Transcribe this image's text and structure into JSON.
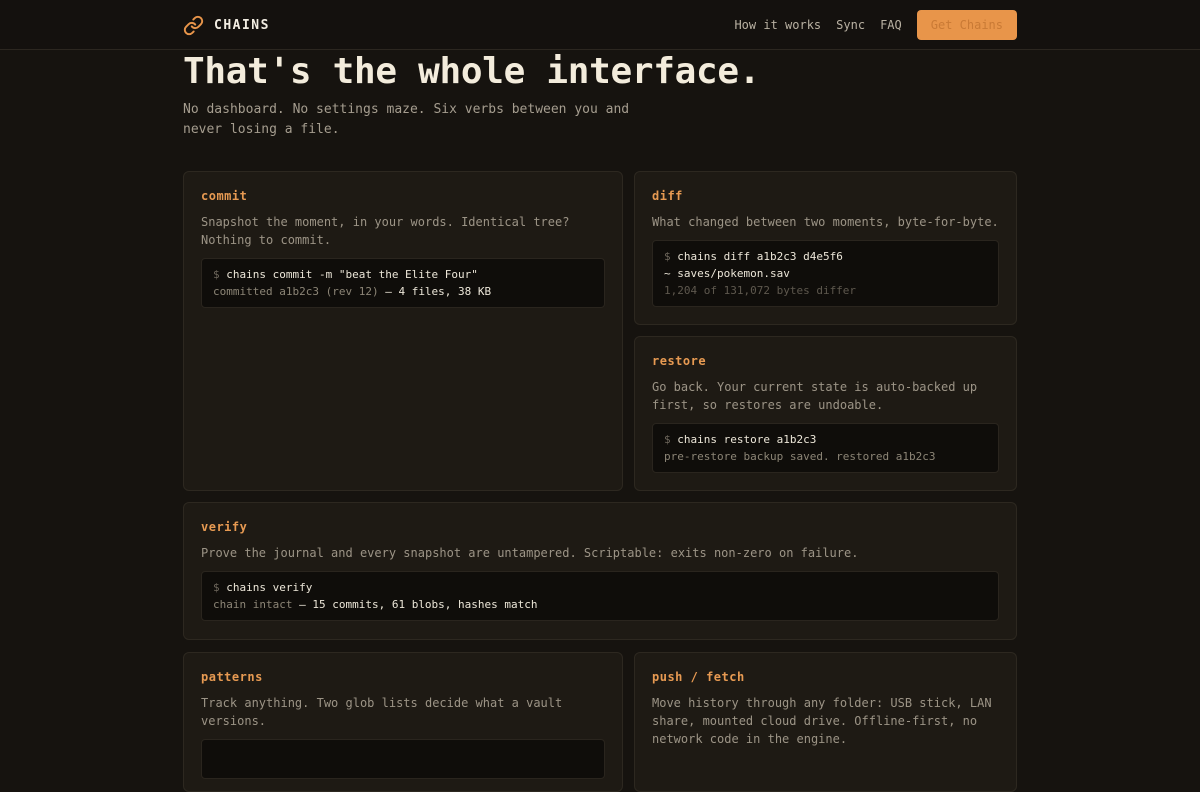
{
  "nav": {
    "brand": "CHAINS",
    "links": [
      "How it works",
      "Sync",
      "FAQ"
    ],
    "cta_label": "Get Chains",
    "accent": "#e8954a"
  },
  "hero": {
    "title": "That's the whole interface.",
    "subtitle": "No dashboard. No settings maze. Six verbs between you and never losing a file."
  },
  "cards": {
    "commit": {
      "title": "commit",
      "desc": "Snapshot the moment, in your words. Identical tree? Nothing to commit.",
      "prompt": "$",
      "cmd": "chains commit -m \"beat the Elite Four\"",
      "out_a": "committed a1b2c3 (rev 12)",
      "out_b": " — 4 files, 38 KB"
    },
    "diff": {
      "title": "diff",
      "desc": "What changed between two moments, byte-for-byte.",
      "prompt": "$",
      "cmd": "chains diff a1b2c3 d4e5f6",
      "out_1": "~ saves/pokemon.sav",
      "out_2": "1,204 of 131,072 bytes differ"
    },
    "restore": {
      "title": "restore",
      "desc": "Go back. Your current state is auto-backed up first, so restores are undoable.",
      "prompt": "$",
      "cmd": "chains restore a1b2c3",
      "out_1": "pre-restore backup saved. restored a1b2c3"
    },
    "verify": {
      "title": "verify",
      "desc": "Prove the journal and every snapshot are untampered. Scriptable: exits non-zero on failure.",
      "prompt": "$",
      "cmd": "chains verify",
      "out_a": "chain intact",
      "out_b": " — 15 commits, 61 blobs, hashes match"
    },
    "patterns": {
      "title": "patterns",
      "desc": "Track anything. Two glob lists decide what a vault versions."
    },
    "push": {
      "title": "push / fetch",
      "desc": "Move history through any folder: USB stick, LAN share, mounted cloud drive. Offline-first, no network code in the engine."
    }
  }
}
